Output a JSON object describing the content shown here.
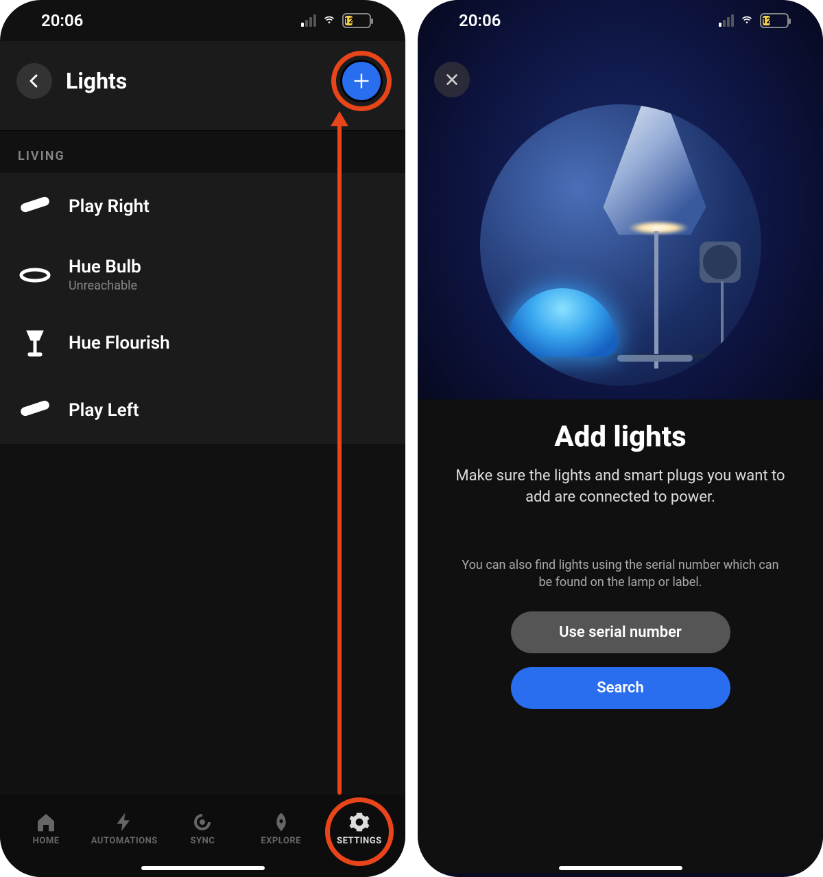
{
  "status": {
    "time": "20:06",
    "battery_pct": 12,
    "cell_active_bars": 1
  },
  "left": {
    "header_title": "Lights",
    "section_label": "LIVING",
    "lights": [
      {
        "name": "Play Right",
        "sub": "",
        "icon": "bar"
      },
      {
        "name": "Hue Bulb",
        "sub": "Unreachable",
        "icon": "ring"
      },
      {
        "name": "Hue Flourish",
        "sub": "",
        "icon": "table-lamp"
      },
      {
        "name": "Play Left",
        "sub": "",
        "icon": "bar"
      }
    ],
    "tabs": [
      {
        "label": "HOME",
        "icon": "home"
      },
      {
        "label": "AUTOMATIONS",
        "icon": "bolt"
      },
      {
        "label": "SYNC",
        "icon": "sync"
      },
      {
        "label": "EXPLORE",
        "icon": "rocket"
      },
      {
        "label": "SETTINGS",
        "icon": "gear"
      }
    ],
    "active_tab": 4,
    "annotation_targets": [
      "add-button",
      "settings-tab"
    ]
  },
  "right": {
    "title": "Add lights",
    "subtitle": "Make sure the lights and smart plugs you want to add are connected to power.",
    "hint": "You can also find lights using the serial number which can be found on the lamp or label.",
    "serial_button": "Use serial number",
    "search_button": "Search"
  },
  "colors": {
    "annotation": "#e8451a",
    "accent_blue": "#2a6ef0",
    "battery_yellow": "#f7d44c"
  }
}
